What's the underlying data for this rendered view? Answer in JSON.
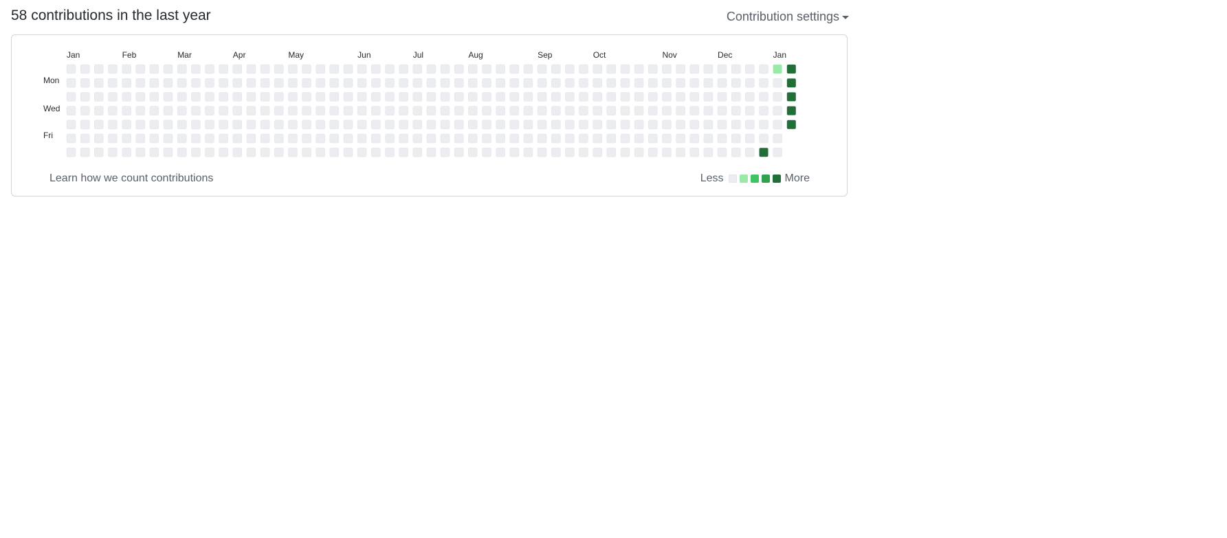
{
  "header": {
    "title": "58 contributions in the last year",
    "settings_label": "Contribution settings"
  },
  "calendar": {
    "months": [
      "Jan",
      "Feb",
      "Mar",
      "Apr",
      "May",
      "Jun",
      "Jul",
      "Aug",
      "Sep",
      "Oct",
      "Nov",
      "Dec",
      "Jan"
    ],
    "month_start_weeks": [
      0,
      4,
      8,
      12,
      16,
      21,
      25,
      29,
      34,
      38,
      43,
      47,
      51
    ],
    "day_labels": {
      "mon": "Mon",
      "wed": "Wed",
      "fri": "Fri"
    },
    "weeks": 53,
    "last_week_days": 5,
    "active_cells": [
      {
        "week": 51,
        "day": 0,
        "level": 1
      },
      {
        "week": 50,
        "day": 6,
        "level": 4
      },
      {
        "week": 52,
        "day": 0,
        "level": 4
      },
      {
        "week": 52,
        "day": 1,
        "level": 4
      },
      {
        "week": 52,
        "day": 2,
        "level": 4
      },
      {
        "week": 52,
        "day": 3,
        "level": 4
      },
      {
        "week": 52,
        "day": 4,
        "level": 4
      }
    ]
  },
  "footer": {
    "learn_link": "Learn how we count contributions",
    "legend_less": "Less",
    "legend_more": "More"
  },
  "colors": {
    "level0": "#ebedf0",
    "level1": "#9be9a8",
    "level2": "#40c463",
    "level3": "#30a14e",
    "level4": "#216e39",
    "cell_border": "#e1e4e8"
  }
}
